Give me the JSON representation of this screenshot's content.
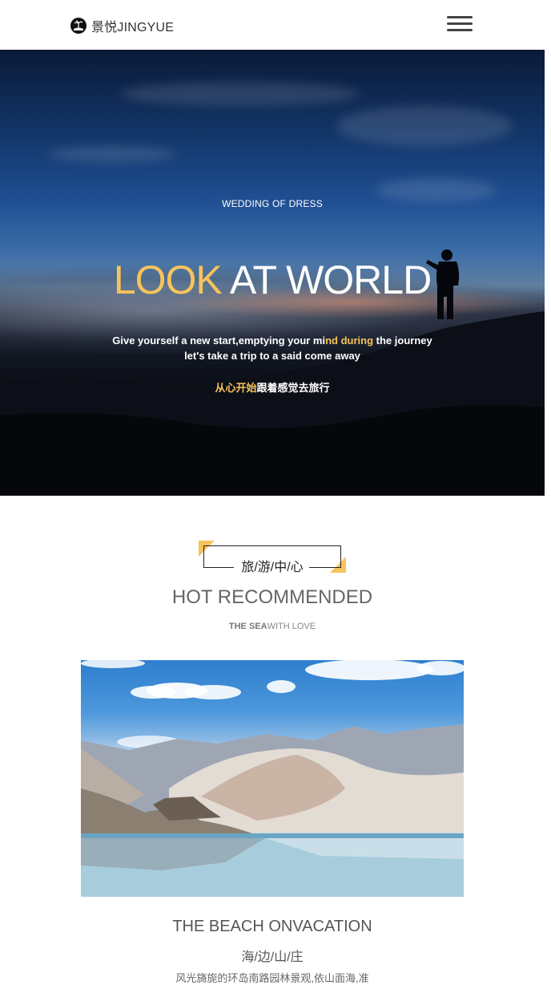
{
  "header": {
    "logo_text": "景悦JINGYUE",
    "logo_icon": "palm-island-icon",
    "menu_icon": "hamburger-menu-icon"
  },
  "hero": {
    "subtitle": "WEDDING OF DRESS",
    "title_highlight": "LOOK",
    "title_rest": " AT WORLD",
    "line1_a": "Give yourself a new start,emptying your mi",
    "line1_hl": "nd during",
    "line1_b": " the journey",
    "line2": "let's take a trip to a said come away",
    "cn_highlight": "从心开始",
    "cn_rest": "跟着感觉去旅行"
  },
  "section": {
    "badge_label": "旅/游/中/心",
    "title": "HOT RECOMMENDED",
    "sub_bold": "THE SEA",
    "sub_rest": "WITH LOVE"
  },
  "card": {
    "title": "THE BEACH ONVACATION",
    "subtitle_cn": "海/边/山/庄",
    "desc": "风光旖旎的环岛南路园林景观,依山面海,准"
  },
  "colors": {
    "accent": "#f7c35b",
    "text_gray": "#666666"
  }
}
